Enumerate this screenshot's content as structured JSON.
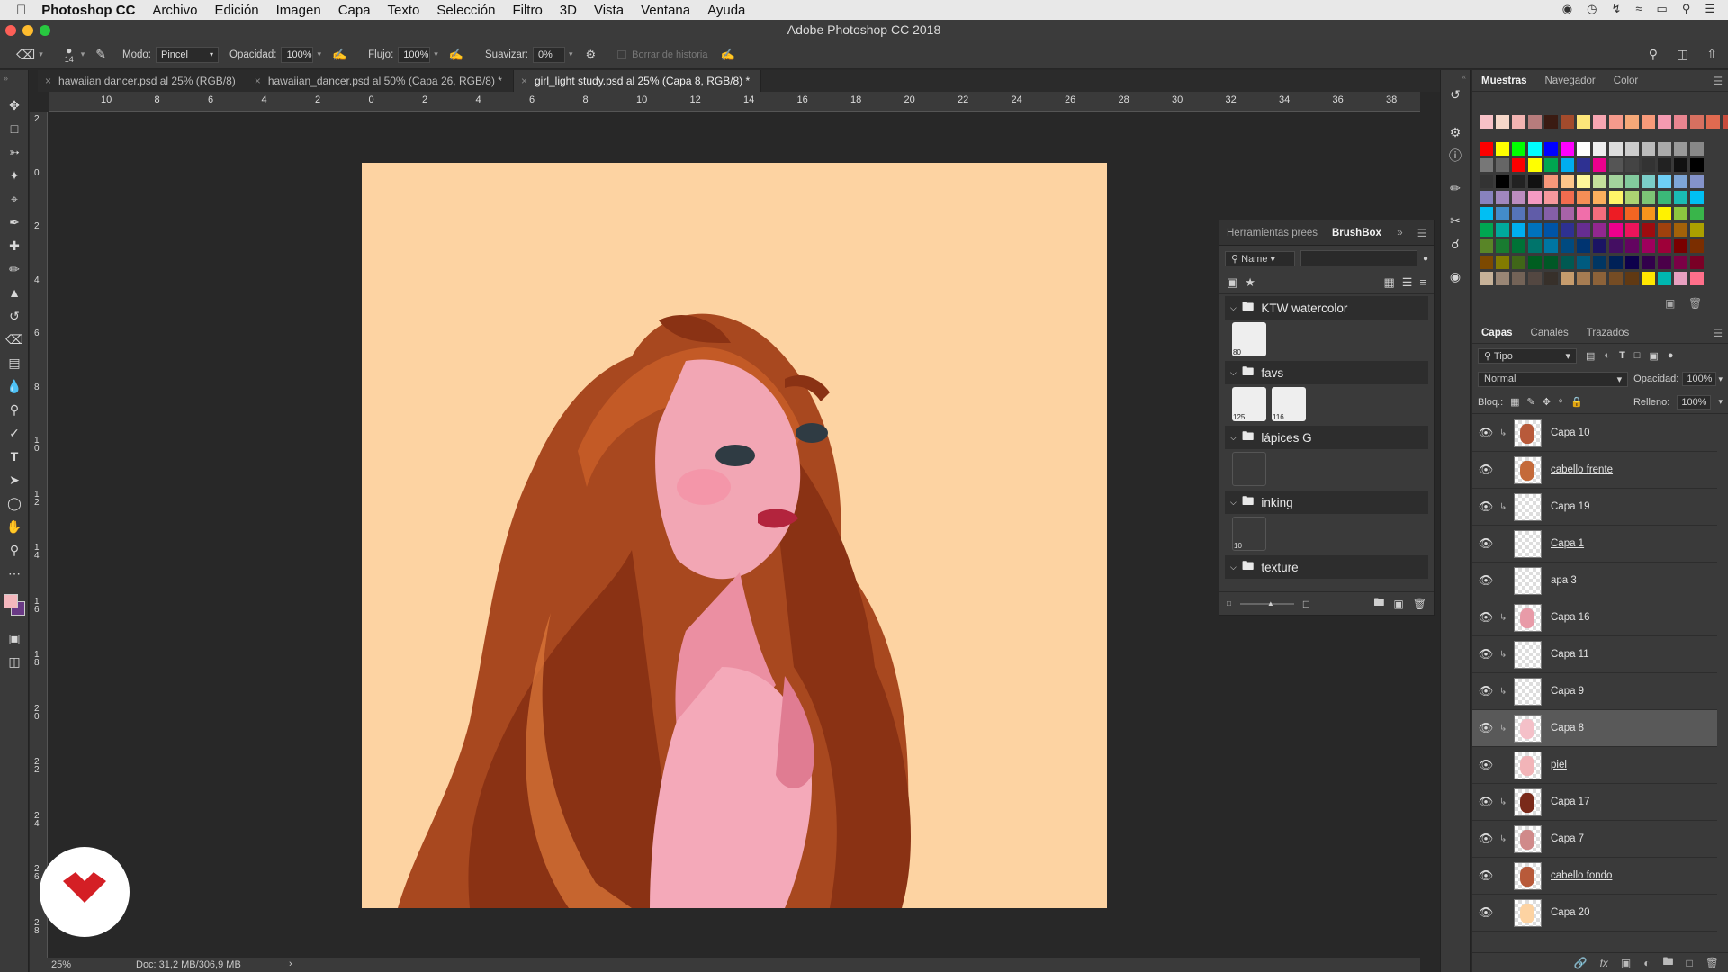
{
  "menubar": {
    "app": "Photoshop CC",
    "items": [
      "Archivo",
      "Edición",
      "Imagen",
      "Capa",
      "Texto",
      "Selección",
      "Filtro",
      "3D",
      "Vista",
      "Ventana",
      "Ayuda"
    ]
  },
  "window": {
    "title": "Adobe Photoshop CC 2018"
  },
  "options": {
    "brush_size": "14",
    "mode_label": "Modo:",
    "mode_value": "Pincel",
    "opacity_label": "Opacidad:",
    "opacity_value": "100%",
    "flow_label": "Flujo:",
    "flow_value": "100%",
    "smooth_label": "Suavizar:",
    "smooth_value": "0%",
    "history_label": "Borrar de historia"
  },
  "tabs": [
    {
      "label": "hawaiian dancer.psd al 25% (RGB/8)"
    },
    {
      "label": "hawaiian_dancer.psd al 50% (Capa 26, RGB/8) *"
    },
    {
      "label": "girl_light study.psd al 25% (Capa 8, RGB/8) *"
    }
  ],
  "ruler": {
    "h": [
      "10",
      "8",
      "6",
      "4",
      "2",
      "0",
      "2",
      "4",
      "6",
      "8",
      "10",
      "12",
      "14",
      "16",
      "18",
      "20",
      "22",
      "24",
      "26",
      "28",
      "30",
      "32",
      "34",
      "36",
      "38"
    ],
    "v": [
      "2",
      "0",
      "2",
      "4",
      "6",
      "8",
      "10",
      "12",
      "14",
      "16",
      "18",
      "20",
      "22",
      "24",
      "26",
      "28"
    ]
  },
  "status": {
    "zoom": "25%",
    "doc": "Doc: 31,2 MB/306,9 MB",
    "arrow": "›"
  },
  "brushbox": {
    "tab1": "Herramientas prees",
    "tab2": "BrushBox",
    "search_label": "Name",
    "folders": [
      {
        "name": "KTW watercolor",
        "brushes": [
          {
            "n": "80"
          }
        ]
      },
      {
        "name": "favs",
        "brushes": [
          {
            "n": "125"
          },
          {
            "n": "116"
          }
        ]
      },
      {
        "name": "lápices G",
        "brushes": [
          {
            "n": ""
          }
        ]
      },
      {
        "name": "inking",
        "brushes": [
          {
            "n": "10"
          }
        ]
      },
      {
        "name": "texture",
        "brushes": []
      }
    ]
  },
  "swatches_panel": {
    "tabs": [
      "Muestras",
      "Navegador",
      "Color"
    ]
  },
  "layers_panel": {
    "tabs": [
      "Capas",
      "Canales",
      "Trazados"
    ],
    "filter": "Tipo",
    "blend": "Normal",
    "opacity_label": "Opacidad:",
    "opacity": "100%",
    "lock_label": "Bloq.:",
    "fill_label": "Relleno:",
    "fill": "100%",
    "layers": [
      {
        "name": "Capa 10",
        "link": false,
        "sel": false,
        "clip": true
      },
      {
        "name": "cabello frente",
        "link": true,
        "sel": false,
        "clip": false
      },
      {
        "name": "Capa 19",
        "link": false,
        "sel": false,
        "clip": true
      },
      {
        "name": "Capa 1",
        "link": true,
        "sel": false,
        "clip": false
      },
      {
        "name": "apa 3",
        "link": false,
        "sel": false,
        "clip": false
      },
      {
        "name": "Capa 16",
        "link": false,
        "sel": false,
        "clip": true
      },
      {
        "name": "Capa 11",
        "link": false,
        "sel": false,
        "clip": true
      },
      {
        "name": "Capa 9",
        "link": false,
        "sel": false,
        "clip": true
      },
      {
        "name": "Capa 8",
        "link": false,
        "sel": true,
        "clip": true
      },
      {
        "name": "piel",
        "link": true,
        "sel": false,
        "clip": false
      },
      {
        "name": "Capa 17",
        "link": false,
        "sel": false,
        "clip": true
      },
      {
        "name": "Capa 7",
        "link": false,
        "sel": false,
        "clip": true
      },
      {
        "name": "cabello fondo",
        "link": true,
        "sel": false,
        "clip": false
      },
      {
        "name": "Capa 20",
        "link": false,
        "sel": false,
        "clip": false
      }
    ]
  },
  "colors": {
    "fg": "#f4b7bd",
    "bg": "#6a3a86",
    "canvas_bg": "#fdd3a2",
    "brand": "#d41f25"
  },
  "swatches": [
    [
      "#f7c1c7",
      "#f6d7c9",
      "#f2b4b2",
      "#b77c7c",
      "#3a1b12",
      "#a34b2c",
      "#fde67a",
      "#f7a6b2",
      "#f59a8c",
      "#f5a878",
      "#f79a7a",
      "#f49ab1",
      "#e98590",
      "#d77060",
      "#e06a50",
      "#c84c3c"
    ],
    [
      "#ff0000",
      "#ffff00",
      "#00ff00",
      "#00ffff",
      "#0000ff",
      "#ff00ff",
      "#ffffff",
      "#eeeeee",
      "#dddddd",
      "#cccccc",
      "#bbbbbb",
      "#aaaaaa",
      "#999999",
      "#888888"
    ],
    [
      "#777777",
      "#666666",
      "#ff0000",
      "#ffff00",
      "#00a650",
      "#00aeef",
      "#2e3192",
      "#ec008c",
      "#555555",
      "#444444",
      "#333333",
      "#222222",
      "#111111",
      "#000000"
    ],
    [
      "#333333",
      "#000000",
      "#222222",
      "#111111",
      "#f7977a",
      "#fdc68a",
      "#fff79a",
      "#c4df9b",
      "#a3d39c",
      "#82ca9d",
      "#7bcdc8",
      "#6ecff6",
      "#7ea7d8",
      "#8493ca"
    ],
    [
      "#8882be",
      "#a187be",
      "#bc8dbf",
      "#f49ac2",
      "#f6989d",
      "#f26c4f",
      "#f68e56",
      "#fbaf5d",
      "#fff568",
      "#acd372",
      "#7cc576",
      "#3bb878",
      "#1abbb4",
      "#00bff3"
    ],
    [
      "#00bff3",
      "#438cca",
      "#5574b9",
      "#605ca8",
      "#855fa8",
      "#a763a8",
      "#f06eaa",
      "#f26d7d",
      "#ed1c24",
      "#f26522",
      "#f7941d",
      "#fff200",
      "#8dc63f",
      "#39b54a"
    ],
    [
      "#00a651",
      "#00a99d",
      "#00aeef",
      "#0072bc",
      "#0054a6",
      "#2e3192",
      "#662d91",
      "#92278f",
      "#ec008c",
      "#ed145b",
      "#9e0b0f",
      "#a0410d",
      "#a36209",
      "#aba000"
    ],
    [
      "#598527",
      "#197b30",
      "#007236",
      "#00746b",
      "#0076a3",
      "#004a80",
      "#003471",
      "#1b1464",
      "#440e62",
      "#630460",
      "#9e005d",
      "#9e0039",
      "#790000",
      "#7b2e00"
    ],
    [
      "#7d4900",
      "#827b00",
      "#406618",
      "#005e20",
      "#005826",
      "#005952",
      "#005b7f",
      "#003663",
      "#002157",
      "#0d004c",
      "#32004b",
      "#4b0049",
      "#7b0046",
      "#7a0026"
    ],
    [
      "#c7b299",
      "#998675",
      "#736357",
      "#534741",
      "#37302a",
      "#c69c6d",
      "#a67c52",
      "#8c6239",
      "#754c24",
      "#603913",
      "#ffe600",
      "#00b7b0",
      "#e8a0c0",
      "#ff6f8a"
    ]
  ]
}
